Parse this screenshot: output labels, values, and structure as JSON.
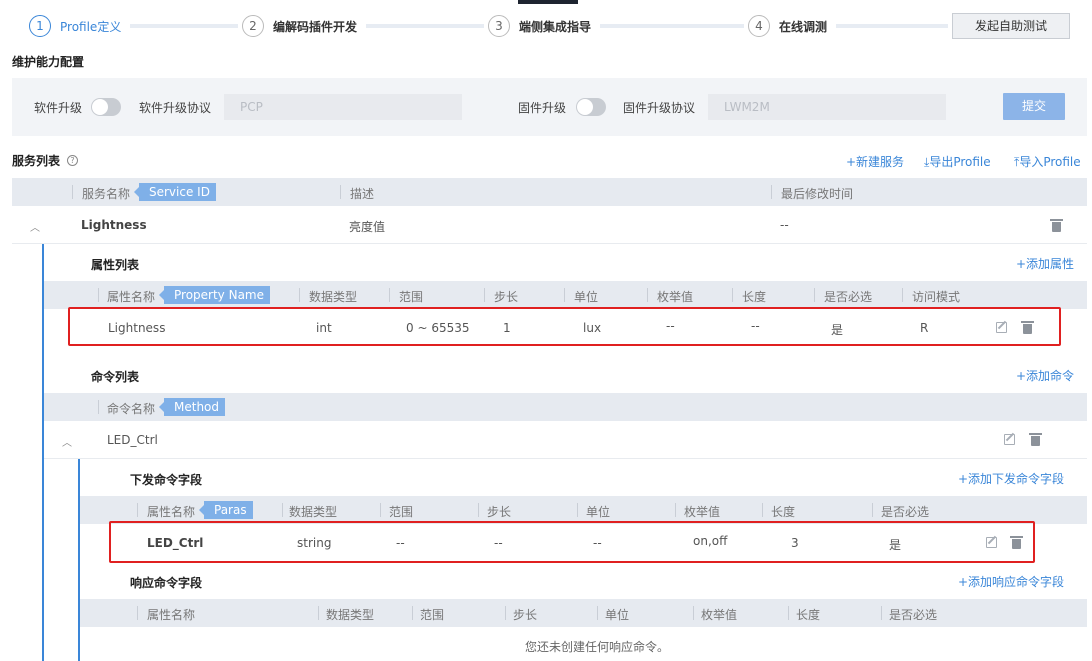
{
  "steps": [
    {
      "num": "1",
      "label": "Profile定义"
    },
    {
      "num": "2",
      "label": "编解码插件开发"
    },
    {
      "num": "3",
      "label": "端侧集成指导"
    },
    {
      "num": "4",
      "label": "在线调测"
    }
  ],
  "self_test_button": "发起自助测试",
  "maintenance": {
    "title": "维护能力配置",
    "software_upgrade_label": "软件升级",
    "software_protocol_label": "软件升级协议",
    "software_protocol_placeholder": "PCP",
    "firmware_upgrade_label": "固件升级",
    "firmware_protocol_label": "固件升级协议",
    "firmware_protocol_placeholder": "LWM2M",
    "submit": "提交"
  },
  "service_list": {
    "title": "服务列表",
    "help": "?",
    "new_service": "+新建服务",
    "export_profile": "导出Profile",
    "import_profile": "导入Profile",
    "columns": {
      "name": "服务名称",
      "tag": "Service ID",
      "desc": "描述",
      "modified": "最后修改时间"
    },
    "service": {
      "name": "Lightness",
      "desc": "亮度值",
      "modified": "--"
    }
  },
  "property_list": {
    "title": "属性列表",
    "add": "+添加属性",
    "columns": {
      "name": "属性名称",
      "tag": "Property Name",
      "type": "数据类型",
      "range": "范围",
      "step": "步长",
      "unit": "单位",
      "enum": "枚举值",
      "length": "长度",
      "required": "是否必选",
      "access": "访问模式"
    },
    "row": {
      "name": "Lightness",
      "type": "int",
      "range": "0 ~ 65535",
      "step": "1",
      "unit": "lux",
      "enum": "--",
      "length": "--",
      "required": "是",
      "access": "R"
    }
  },
  "command_list": {
    "title": "命令列表",
    "add": "+添加命令",
    "columns": {
      "name": "命令名称",
      "tag": "Method"
    },
    "command": {
      "name": "LED_Ctrl"
    }
  },
  "down_fields": {
    "title": "下发命令字段",
    "add": "+添加下发命令字段",
    "columns": {
      "name": "属性名称",
      "tag": "Paras",
      "type": "数据类型",
      "range": "范围",
      "step": "步长",
      "unit": "单位",
      "enum": "枚举值",
      "length": "长度",
      "required": "是否必选"
    },
    "row": {
      "name": "LED_Ctrl",
      "type": "string",
      "range": "--",
      "step": "--",
      "unit": "--",
      "enum": "on,off",
      "length": "3",
      "required": "是"
    }
  },
  "resp_fields": {
    "title": "响应命令字段",
    "add": "+添加响应命令字段",
    "columns": {
      "name": "属性名称",
      "type": "数据类型",
      "range": "范围",
      "step": "步长",
      "unit": "单位",
      "enum": "枚举值",
      "length": "长度",
      "required": "是否必选"
    },
    "empty": "您还未创建任何响应命令。"
  }
}
